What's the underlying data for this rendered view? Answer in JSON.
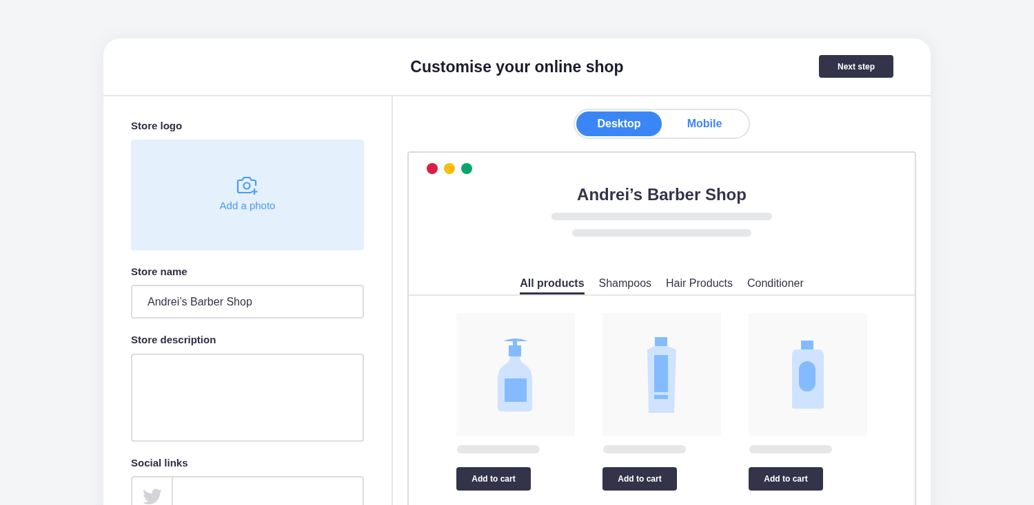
{
  "header": {
    "title": "Customise your online shop",
    "next_button": "Next step"
  },
  "form": {
    "logo_label": "Store logo",
    "add_photo": "Add a photo",
    "name_label": "Store name",
    "name_value": "Andrei’s Barber Shop",
    "description_label": "Store description",
    "social_label": "Social links"
  },
  "view_toggle": [
    {
      "label": "Desktop",
      "selected": true
    },
    {
      "label": "Mobile",
      "selected": false
    }
  ],
  "preview": {
    "window_dots": [
      {
        "color": "#dc1d44"
      },
      {
        "color": "#fdbb0b"
      },
      {
        "color": "#09a66b"
      }
    ],
    "shop_title": "Andrei’s Barber Shop",
    "tabs": [
      {
        "label": "All products",
        "selected": true
      },
      {
        "label": "Shampoos",
        "selected": false
      },
      {
        "label": "Hair Products",
        "selected": false
      },
      {
        "label": "Conditioner",
        "selected": false
      }
    ],
    "products": [
      {
        "kind": "pump",
        "button": "Add to cart"
      },
      {
        "kind": "tube",
        "button": "Add to cart"
      },
      {
        "kind": "bottle",
        "button": "Add to cart"
      }
    ]
  }
}
